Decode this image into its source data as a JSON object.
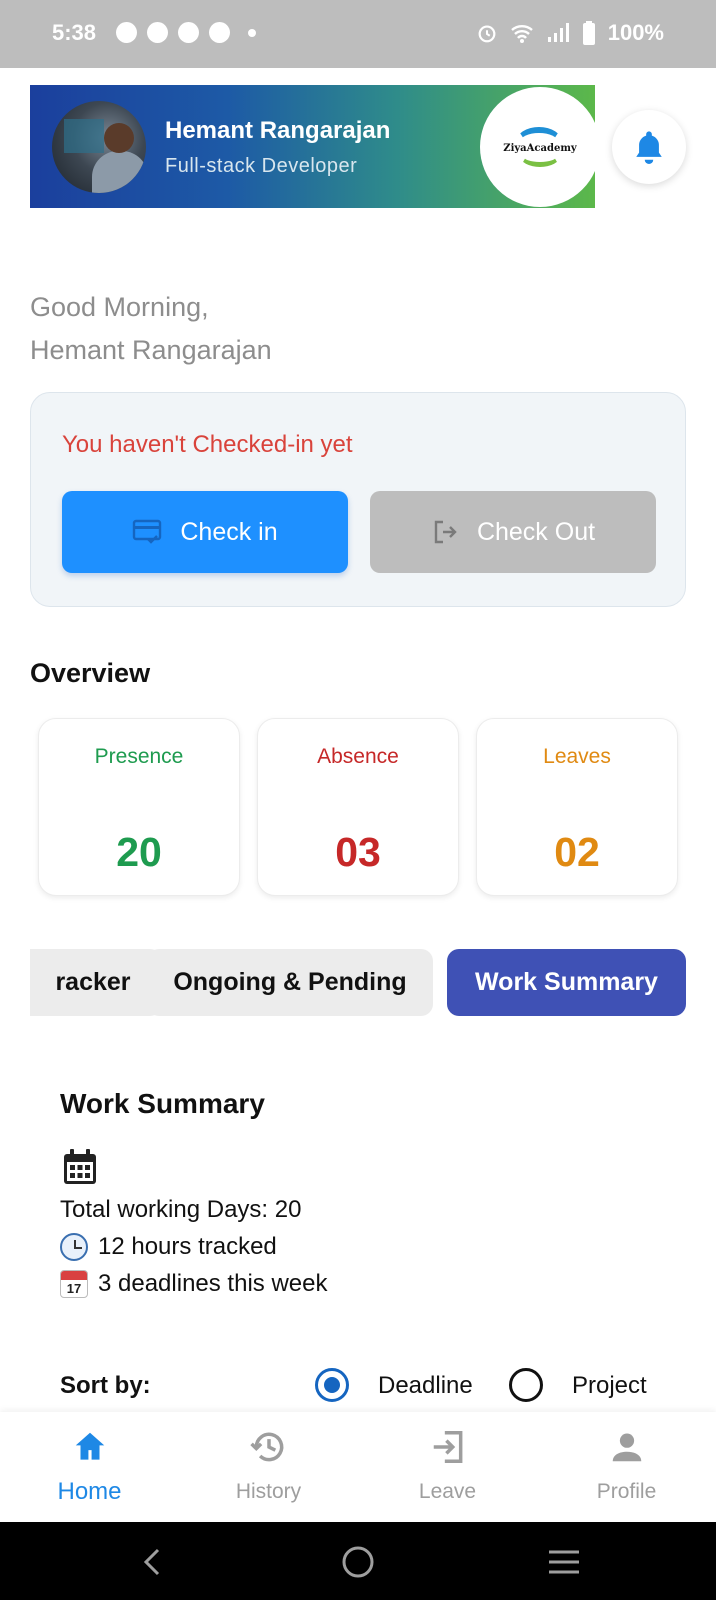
{
  "status_bar": {
    "time": "5:38",
    "battery": "100%"
  },
  "header": {
    "user_name": "Hemant Rangarajan",
    "user_role": "Full-stack Developer",
    "logo_text": "ZiyaAcademy",
    "accent_color": "#1e90ff"
  },
  "greeting": {
    "line1": "Good Morning,",
    "line2": "Hemant Rangarajan"
  },
  "checkin": {
    "status_text": "You haven't Checked-in yet",
    "check_in_label": "Check in",
    "check_out_label": "Check Out"
  },
  "overview": {
    "title": "Overview",
    "stats": [
      {
        "label": "Presence",
        "value": "20",
        "color": "#1e9b4f"
      },
      {
        "label": "Absence",
        "value": "03",
        "color": "#c62828"
      },
      {
        "label": "Leaves",
        "value": "02",
        "color": "#e08a12"
      }
    ]
  },
  "tabs": [
    {
      "label": "racker"
    },
    {
      "label": "Ongoing & Pending"
    },
    {
      "label": "Work Summary"
    }
  ],
  "work_summary": {
    "title": "Work Summary",
    "total_days": "Total working Days: 20",
    "hours": "12 hours tracked",
    "deadlines": "3 deadlines this week",
    "calendar_emoji_day": "17"
  },
  "sort": {
    "label": "Sort by:",
    "options": [
      {
        "label": "Deadline",
        "selected": true
      },
      {
        "label": "Project",
        "selected": false
      }
    ]
  },
  "bottom_nav": [
    {
      "label": "Home",
      "icon": "home-icon",
      "active": true
    },
    {
      "label": "History",
      "icon": "history-icon",
      "active": false
    },
    {
      "label": "Leave",
      "icon": "leave-icon",
      "active": false
    },
    {
      "label": "Profile",
      "icon": "profile-icon",
      "active": false
    }
  ]
}
